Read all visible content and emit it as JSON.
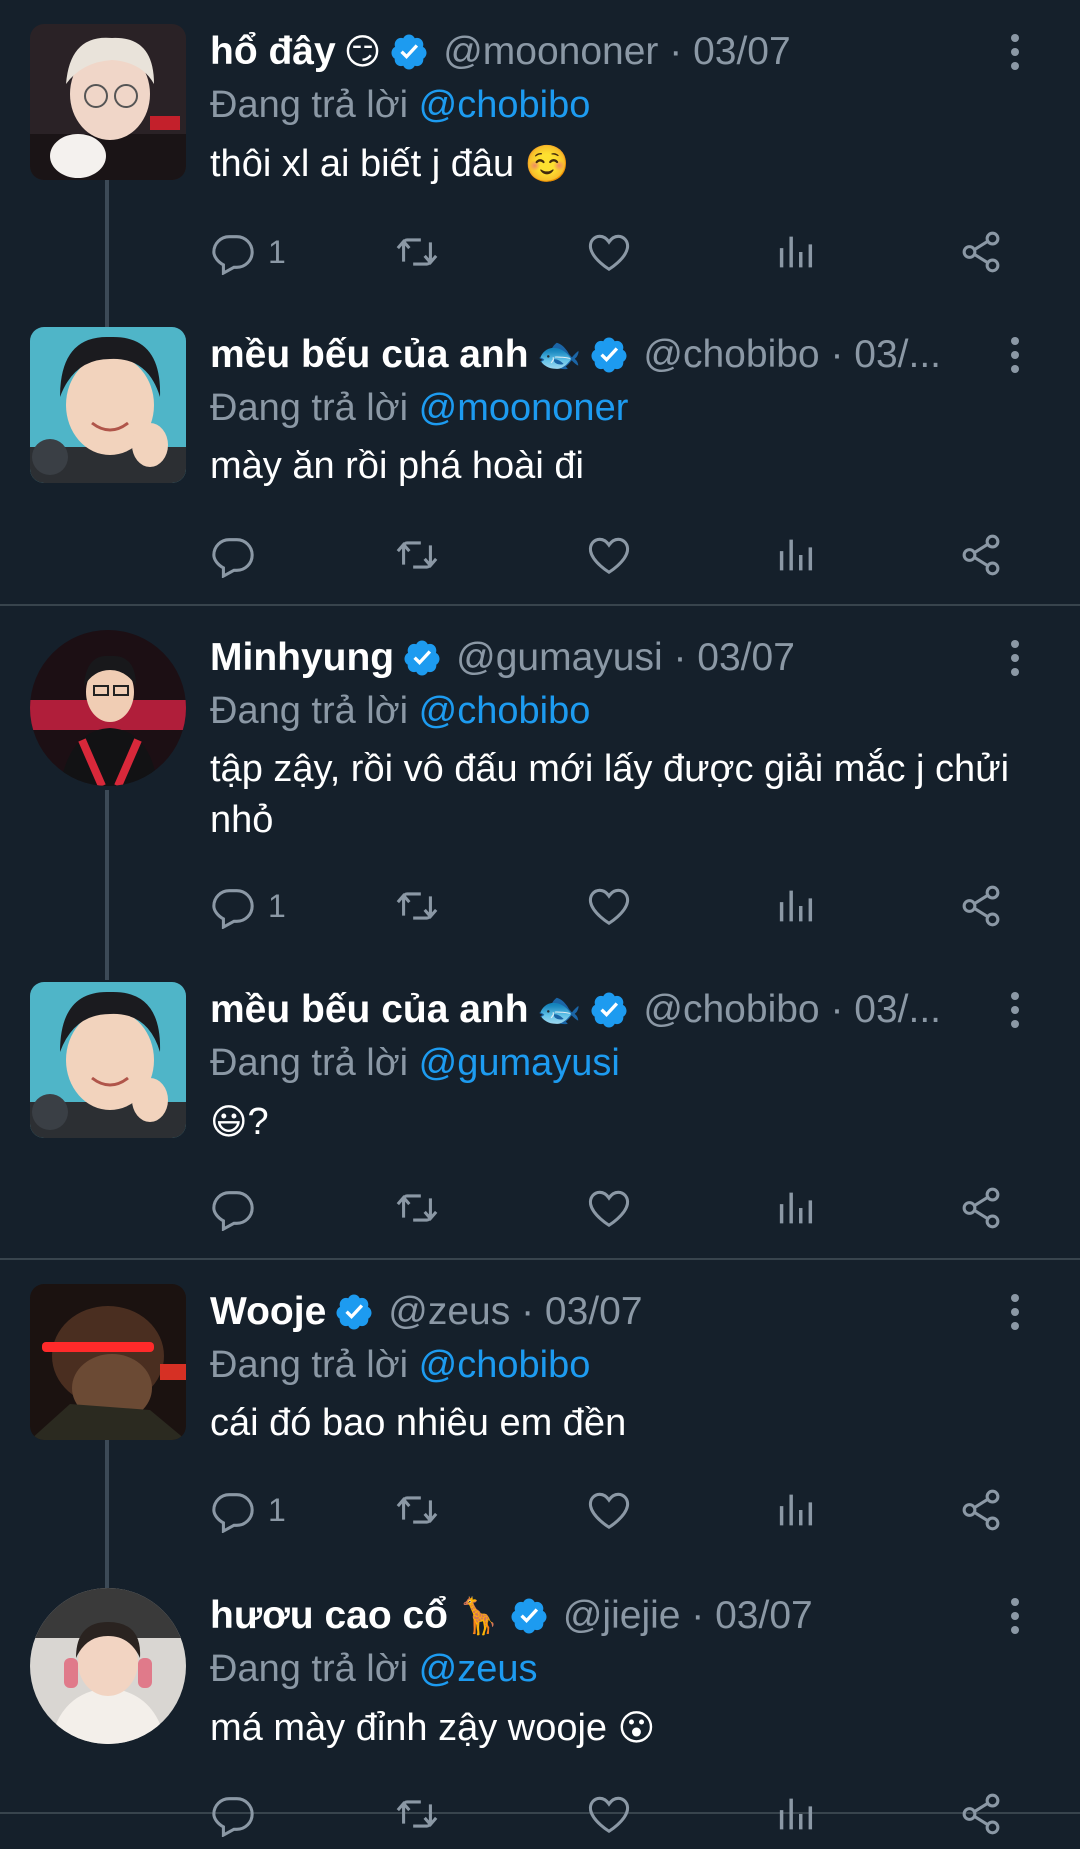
{
  "reply_prefix": "Đang trả lời",
  "colors": {
    "background": "#15202b",
    "muted": "#8b98a5",
    "accent": "#1d9bf0",
    "divider": "#38444d",
    "thread_line": "#3c4a57"
  },
  "tweets": [
    {
      "name": "hổ đây",
      "name_emoji": "😏",
      "meta": "@moononer · 03/07",
      "mention": "@chobibo",
      "text": "thôi xl ai biết j đâu",
      "text_emoji": "☺️",
      "reply_count": "1",
      "avatar_icon": "avatar-blonde-glasses"
    },
    {
      "name": "mều bếu của anh",
      "name_emoji": "🐟",
      "meta": "@chobibo · 03/...",
      "mention": "@moononer",
      "text": "mày ăn rồi phá hoài đi",
      "text_emoji": "",
      "reply_count": "",
      "avatar_icon": "avatar-smiling-boy"
    },
    {
      "name": "Minhyung",
      "name_emoji": "",
      "meta": "@gumayusi · 03/07",
      "mention": "@chobibo",
      "text": "tập zậy, rồi vô đấu mới lấy được giải mắc j chửi nhỏ",
      "text_emoji": "",
      "reply_count": "1",
      "avatar_icon": "avatar-red-jacket"
    },
    {
      "name": "mều bếu của anh",
      "name_emoji": "🐟",
      "meta": "@chobibo · 03/...",
      "mention": "@gumayusi",
      "text": "?",
      "text_emoji": "😃",
      "reply_count": "",
      "avatar_icon": "avatar-smiling-boy"
    },
    {
      "name": "Wooje",
      "name_emoji": "",
      "meta": "@zeus · 03/07",
      "mention": "@chobibo",
      "text": "cái đó bao nhiêu em đền",
      "text_emoji": "",
      "reply_count": "1",
      "avatar_icon": "avatar-dark-red-light"
    },
    {
      "name": "hươu cao cổ",
      "name_emoji": "🦒",
      "meta": "@jiejie · 03/07",
      "mention": "@zeus",
      "text": "má mày đỉnh zậy wooje",
      "text_emoji": "😮",
      "reply_count": "",
      "avatar_icon": "avatar-headphones"
    }
  ],
  "action_icons": [
    "reply-icon",
    "retweet-icon",
    "like-icon",
    "views-icon",
    "share-icon"
  ]
}
